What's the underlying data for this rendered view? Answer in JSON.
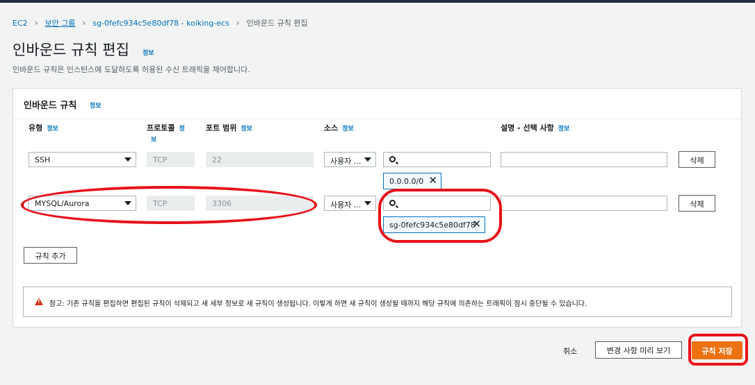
{
  "breadcrumb": {
    "items": [
      "EC2",
      "보안 그룹",
      "sg-0fefc934c5e80df78 - koiking-ecs"
    ],
    "current": "인바운드 규칙 편집"
  },
  "page": {
    "title": "인바운드 규칙 편집",
    "info": "정보",
    "description": "인바운드 규칙은 인스턴스에 도달하도록 허용된 수신 트래픽을 제어합니다."
  },
  "panel": {
    "title": "인바운드 규칙",
    "info": "정보",
    "columns": {
      "type": "유형",
      "protocol": "프로토콜",
      "port": "포트 범위",
      "source": "소스",
      "description": "설명 - 선택 사항",
      "info": "정보",
      "info_part1": "정",
      "info_part2": "보"
    },
    "rules": [
      {
        "type": "SSH",
        "protocol": "TCP",
        "port": "22",
        "source_type": "사용자 ...",
        "source_token": "0.0.0.0/0",
        "delete": "삭제"
      },
      {
        "type": "MYSQL/Aurora",
        "protocol": "TCP",
        "port": "3306",
        "source_type": "사용자 ...",
        "source_token": "sg-0fefc934c5e80df78",
        "delete": "삭제"
      }
    ],
    "add_rule": "규칙 추가",
    "alert": "참고: 기존 규칙을 편집하면 편집된 규칙이 삭제되고 새 세부 정보로 새 규칙이 생성됩니다. 이렇게 하면 새 규칙이 생성될 때까지 해당 규칙에 의존하는 트래픽이 잠시 중단될 수 있습니다."
  },
  "footer": {
    "cancel": "취소",
    "preview": "변경 사항 미리 보기",
    "save": "규칙 저장"
  },
  "colors": {
    "primary": "#ec7211",
    "link": "#0073bb",
    "highlight": "#e8111a"
  }
}
